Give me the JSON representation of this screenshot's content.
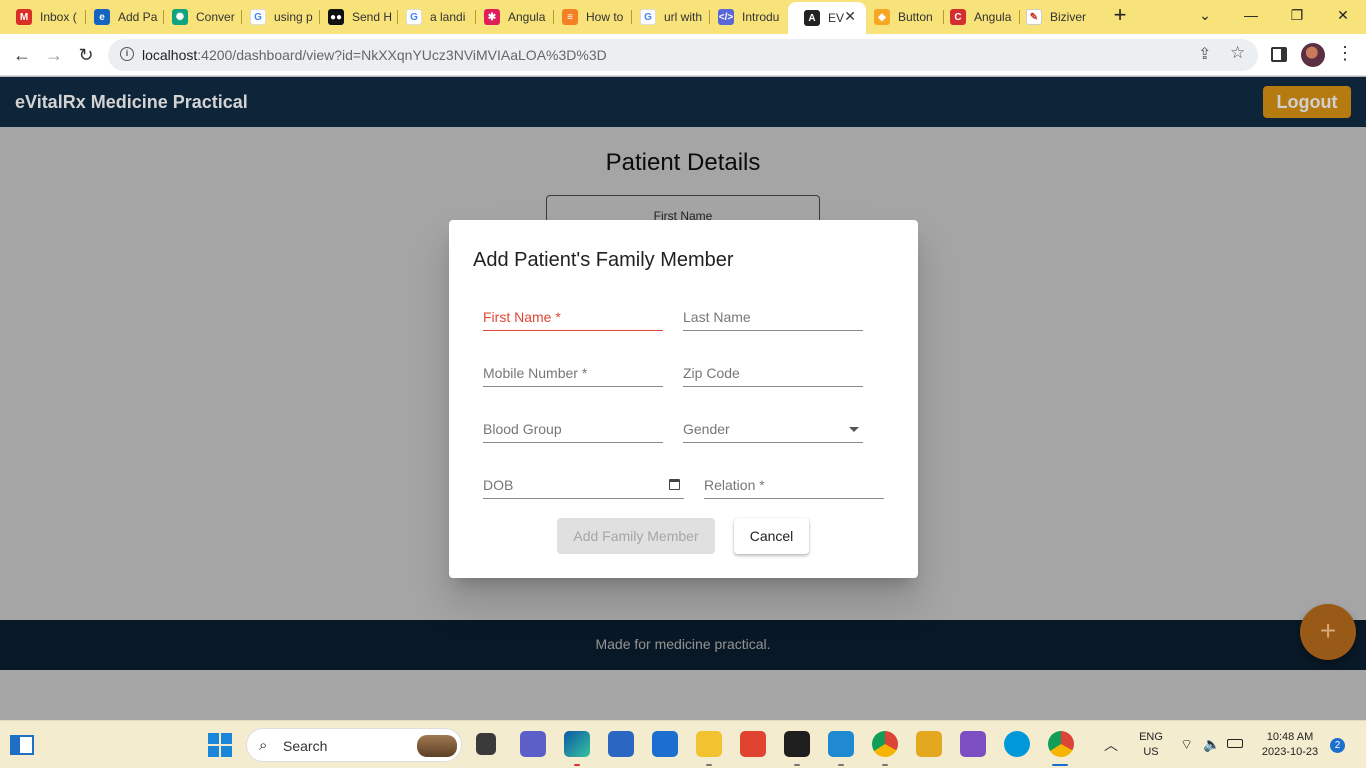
{
  "browser": {
    "tabs": [
      {
        "label": "Inbox (",
        "icon": "gmail-icon",
        "color": "#d93025"
      },
      {
        "label": "Add Pa",
        "icon": "edge-icon",
        "color": "#1565c0"
      },
      {
        "label": "Conver",
        "icon": "chatgpt-icon",
        "color": "#10a37f"
      },
      {
        "label": "using p",
        "icon": "google-icon",
        "color": "#4285f4"
      },
      {
        "label": "Send H",
        "icon": "medium-icon",
        "color": "#111111"
      },
      {
        "label": "a landi",
        "icon": "google-icon",
        "color": "#4285f4"
      },
      {
        "label": "Angula",
        "icon": "slack-icon",
        "color": "#e01e5a"
      },
      {
        "label": "How to",
        "icon": "stackoverflow-icon",
        "color": "#f48024"
      },
      {
        "label": "url with",
        "icon": "google-icon",
        "color": "#4285f4"
      },
      {
        "label": "Introdu",
        "icon": "code-icon",
        "color": "#5a67d8"
      },
      {
        "label": "EV",
        "icon": "angular-icon",
        "color": "#222222",
        "active": true
      },
      {
        "label": "Button",
        "icon": "brave-icon",
        "color": "#f5a623"
      },
      {
        "label": "Angula",
        "icon": "codecademy-icon",
        "color": "#d32f2f"
      },
      {
        "label": "Biziver",
        "icon": "page-icon",
        "color": "#c0392b"
      }
    ],
    "url_host": "localhost",
    "url_rest": ":4200/dashboard/view?id=NkXXqnYUcz3NViMVIAaLOA%3D%3D"
  },
  "header": {
    "title": "eVitalRx Medicine Practical",
    "logout_label": "Logout"
  },
  "page": {
    "title": "Patient Details",
    "background_field_label": "First Name",
    "footer_text": "Made for medicine practical.",
    "fab_symbol": "+"
  },
  "dialog": {
    "title": "Add Patient's Family Member",
    "fields": {
      "first_name": "First Name *",
      "last_name": "Last Name",
      "mobile": "Mobile Number *",
      "zip": "Zip Code",
      "blood_group": "Blood Group",
      "gender": "Gender",
      "dob": "DOB",
      "relation": "Relation *"
    },
    "add_button": "Add Family Member",
    "cancel_button": "Cancel"
  },
  "taskbar": {
    "search_label": "Search",
    "lang_top": "ENG",
    "lang_bottom": "US",
    "time": "10:48 AM",
    "date": "2023-10-23",
    "notifications": "2"
  },
  "colors": {
    "header_bg": "#0e2438",
    "logout_bg": "#b57a10",
    "error": "#e04835",
    "fab_bg": "#9a5a17",
    "tabstrip_bg": "#f8e27a"
  }
}
